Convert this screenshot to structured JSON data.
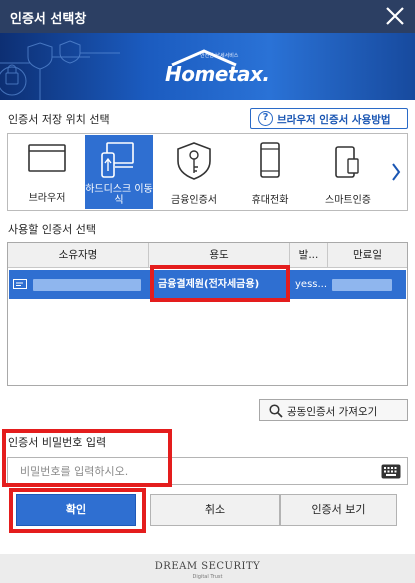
{
  "window": {
    "title": "인증서 선택창"
  },
  "banner": {
    "logo_sub": "안전한 납세서비스",
    "logo_text": "Hometax."
  },
  "storage": {
    "section_label": "인증서 저장 위치 선택",
    "help_button": "브라우저 인증서 사용방법",
    "items": [
      {
        "label": "브라우저",
        "icon": "browser-window-icon",
        "active": false
      },
      {
        "label": "하드디스크 이동식",
        "icon": "usb-drive-icon",
        "active": true
      },
      {
        "label": "금융인증서",
        "icon": "shield-key-icon",
        "active": false
      },
      {
        "label": "휴대전화",
        "icon": "mobile-phone-icon",
        "active": false
      },
      {
        "label": "스마트인증",
        "icon": "smart-phone-icon",
        "active": false
      }
    ]
  },
  "cert_list": {
    "section_label": "사용할 인증서 선택",
    "columns": [
      "소유자명",
      "용도",
      "발...",
      "만료일"
    ],
    "rows": [
      {
        "usage": "금융결제원(전자세금용)",
        "issuer": "yess..."
      }
    ]
  },
  "import_button": "공동인증서 가져오기",
  "password": {
    "label": "인증서 비밀번호 입력",
    "placeholder": "비밀번호를 입력하시오."
  },
  "buttons": {
    "confirm": "확인",
    "cancel": "취소",
    "view_cert": "인증서 보기"
  },
  "footer": {
    "brand": "DREAM SECURITY",
    "tagline": "Digital Trust"
  },
  "colors": {
    "titlebar": "#2c3f63",
    "accent": "#2f6fd1",
    "highlight": "#e41d1d"
  }
}
